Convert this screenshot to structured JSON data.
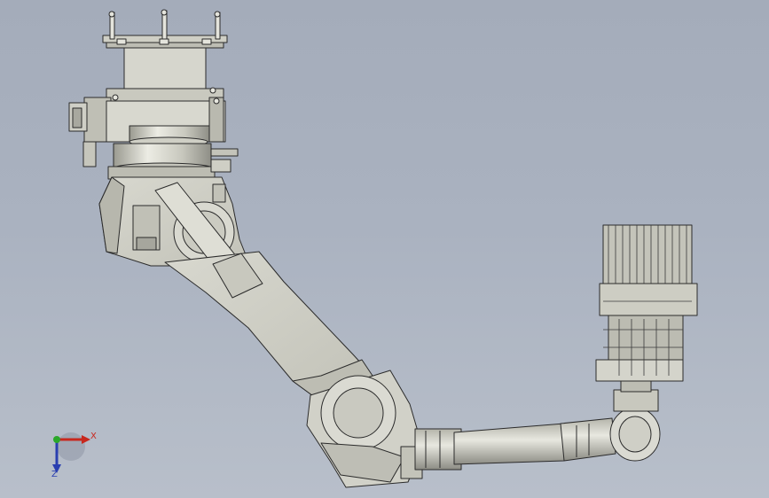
{
  "viewport": {
    "background_top": "#a4acba",
    "background_bottom": "#b8bfca",
    "model_color": "#d2d2c8",
    "edge_color": "#2b2b2b"
  },
  "triad": {
    "x_label": "X",
    "z_label": "Z",
    "x_color": "#c8281e",
    "y_color": "#2aa82a",
    "z_color": "#2a3fb0"
  }
}
